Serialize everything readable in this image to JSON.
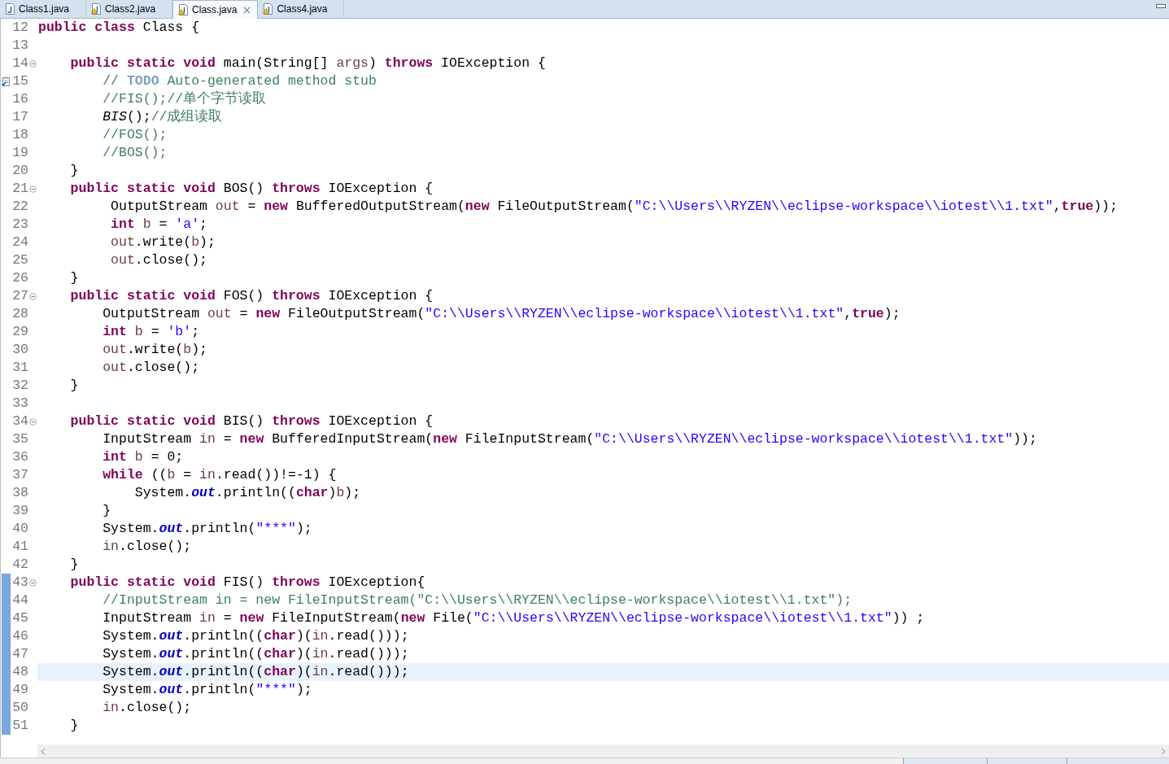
{
  "tabs": [
    {
      "label": "Class1.java",
      "selected": false,
      "warning": false
    },
    {
      "label": "Class2.java",
      "selected": false,
      "warning": true
    },
    {
      "label": "Class.java",
      "selected": true,
      "warning": true
    },
    {
      "label": "Class4.java",
      "selected": false,
      "warning": true
    }
  ],
  "lines": [
    {
      "number": "12",
      "fold": false,
      "changed": false,
      "current": false,
      "tokens": [
        {
          "kind": "kw",
          "text": "public class"
        },
        {
          "kind": "t",
          "text": " Class {"
        }
      ]
    },
    {
      "number": "13",
      "fold": false,
      "changed": false,
      "current": false
    },
    {
      "number": "14",
      "fold": true,
      "changed": false,
      "current": false,
      "tokens": [
        {
          "kind": "kw",
          "text": "    public static void"
        },
        {
          "kind": "t",
          "text": " main(String[] "
        },
        {
          "kind": "v",
          "text": "args"
        },
        {
          "kind": "t",
          "text": ") "
        },
        {
          "kind": "kw",
          "text": "throws"
        },
        {
          "kind": "t",
          "text": " IOException {"
        }
      ]
    },
    {
      "number": "15",
      "fold": false,
      "changed": false,
      "current": false,
      "task": true,
      "tokens": [
        {
          "kind": "c",
          "text": "        // "
        },
        {
          "kind": "todo",
          "text": "TODO"
        },
        {
          "kind": "c",
          "text": " Auto-generated method stub"
        }
      ]
    },
    {
      "number": "16",
      "fold": false,
      "changed": false,
      "current": false,
      "tokens": [
        {
          "kind": "c",
          "text": "        //FIS();//单个字节读取"
        }
      ]
    },
    {
      "number": "17",
      "fold": false,
      "changed": false,
      "current": false,
      "tokens": [
        {
          "kind": "sm",
          "text": "        BIS"
        },
        {
          "kind": "t",
          "text": "();"
        },
        {
          "kind": "c",
          "text": "//成组读取"
        }
      ]
    },
    {
      "number": "18",
      "fold": false,
      "changed": false,
      "current": false,
      "tokens": [
        {
          "kind": "c",
          "text": "        //FOS();"
        }
      ]
    },
    {
      "number": "19",
      "fold": false,
      "changed": false,
      "current": false,
      "tokens": [
        {
          "kind": "c",
          "text": "        //BOS();"
        }
      ]
    },
    {
      "number": "20",
      "fold": false,
      "changed": false,
      "current": false,
      "tokens": [
        {
          "kind": "t",
          "text": "    }"
        }
      ]
    },
    {
      "number": "21",
      "fold": true,
      "changed": false,
      "current": false,
      "tokens": [
        {
          "kind": "kw",
          "text": "    public static void"
        },
        {
          "kind": "t",
          "text": " BOS() "
        },
        {
          "kind": "kw",
          "text": "throws"
        },
        {
          "kind": "t",
          "text": " IOException {"
        }
      ]
    },
    {
      "number": "22",
      "fold": false,
      "changed": false,
      "current": false,
      "tokens": [
        {
          "kind": "t",
          "text": "         OutputStream "
        },
        {
          "kind": "v",
          "text": "out"
        },
        {
          "kind": "t",
          "text": " = "
        },
        {
          "kind": "kw",
          "text": "new"
        },
        {
          "kind": "t",
          "text": " BufferedOutputStream("
        },
        {
          "kind": "kw",
          "text": "new"
        },
        {
          "kind": "t",
          "text": " FileOutputStream("
        },
        {
          "kind": "s",
          "text": "\"C:\\\\Users\\\\RYZEN\\\\eclipse-workspace\\\\iotest\\\\1.txt\""
        },
        {
          "kind": "t",
          "text": ","
        },
        {
          "kind": "kw",
          "text": "true"
        },
        {
          "kind": "t",
          "text": "));"
        }
      ]
    },
    {
      "number": "23",
      "fold": false,
      "changed": false,
      "current": false,
      "tokens": [
        {
          "kind": "kw",
          "text": "         int"
        },
        {
          "kind": "v",
          "text": " b"
        },
        {
          "kind": "t",
          "text": " = "
        },
        {
          "kind": "s",
          "text": "'a'"
        },
        {
          "kind": "t",
          "text": ";"
        }
      ]
    },
    {
      "number": "24",
      "fold": false,
      "changed": false,
      "current": false,
      "tokens": [
        {
          "kind": "v",
          "text": "         out"
        },
        {
          "kind": "t",
          "text": ".write("
        },
        {
          "kind": "v",
          "text": "b"
        },
        {
          "kind": "t",
          "text": ");"
        }
      ]
    },
    {
      "number": "25",
      "fold": false,
      "changed": false,
      "current": false,
      "tokens": [
        {
          "kind": "v",
          "text": "         out"
        },
        {
          "kind": "t",
          "text": ".close();"
        }
      ]
    },
    {
      "number": "26",
      "fold": false,
      "changed": false,
      "current": false,
      "tokens": [
        {
          "kind": "t",
          "text": "    }"
        }
      ]
    },
    {
      "number": "27",
      "fold": true,
      "changed": false,
      "current": false,
      "tokens": [
        {
          "kind": "kw",
          "text": "    public static void"
        },
        {
          "kind": "t",
          "text": " FOS() "
        },
        {
          "kind": "kw",
          "text": "throws"
        },
        {
          "kind": "t",
          "text": " IOException {"
        }
      ]
    },
    {
      "number": "28",
      "fold": false,
      "changed": false,
      "current": false,
      "tokens": [
        {
          "kind": "t",
          "text": "        OutputStream "
        },
        {
          "kind": "v",
          "text": "out"
        },
        {
          "kind": "t",
          "text": " = "
        },
        {
          "kind": "kw",
          "text": "new"
        },
        {
          "kind": "t",
          "text": " FileOutputStream("
        },
        {
          "kind": "s",
          "text": "\"C:\\\\Users\\\\RYZEN\\\\eclipse-workspace\\\\iotest\\\\1.txt\""
        },
        {
          "kind": "t",
          "text": ","
        },
        {
          "kind": "kw",
          "text": "true"
        },
        {
          "kind": "t",
          "text": ");"
        }
      ]
    },
    {
      "number": "29",
      "fold": false,
      "changed": false,
      "current": false,
      "tokens": [
        {
          "kind": "kw",
          "text": "        int"
        },
        {
          "kind": "v",
          "text": " b"
        },
        {
          "kind": "t",
          "text": " = "
        },
        {
          "kind": "s",
          "text": "'b'"
        },
        {
          "kind": "t",
          "text": ";"
        }
      ]
    },
    {
      "number": "30",
      "fold": false,
      "changed": false,
      "current": false,
      "tokens": [
        {
          "kind": "v",
          "text": "        out"
        },
        {
          "kind": "t",
          "text": ".write("
        },
        {
          "kind": "v",
          "text": "b"
        },
        {
          "kind": "t",
          "text": ");"
        }
      ]
    },
    {
      "number": "31",
      "fold": false,
      "changed": false,
      "current": false,
      "tokens": [
        {
          "kind": "v",
          "text": "        out"
        },
        {
          "kind": "t",
          "text": ".close();"
        }
      ]
    },
    {
      "number": "32",
      "fold": false,
      "changed": false,
      "current": false,
      "tokens": [
        {
          "kind": "t",
          "text": "    }"
        }
      ]
    },
    {
      "number": "33",
      "fold": false,
      "changed": false,
      "current": false
    },
    {
      "number": "34",
      "fold": true,
      "changed": false,
      "current": false,
      "tokens": [
        {
          "kind": "kw",
          "text": "    public static void"
        },
        {
          "kind": "t",
          "text": " BIS() "
        },
        {
          "kind": "kw",
          "text": "throws"
        },
        {
          "kind": "t",
          "text": " IOException {"
        }
      ]
    },
    {
      "number": "35",
      "fold": false,
      "changed": false,
      "current": false,
      "tokens": [
        {
          "kind": "t",
          "text": "        InputStream "
        },
        {
          "kind": "v",
          "text": "in"
        },
        {
          "kind": "t",
          "text": " = "
        },
        {
          "kind": "kw",
          "text": "new"
        },
        {
          "kind": "t",
          "text": " BufferedInputStream("
        },
        {
          "kind": "kw",
          "text": "new"
        },
        {
          "kind": "t",
          "text": " FileInputStream("
        },
        {
          "kind": "s",
          "text": "\"C:\\\\Users\\\\RYZEN\\\\eclipse-workspace\\\\iotest\\\\1.txt\""
        },
        {
          "kind": "t",
          "text": "));"
        }
      ]
    },
    {
      "number": "36",
      "fold": false,
      "changed": false,
      "current": false,
      "tokens": [
        {
          "kind": "kw",
          "text": "        int"
        },
        {
          "kind": "v",
          "text": " b"
        },
        {
          "kind": "t",
          "text": " = 0;"
        }
      ]
    },
    {
      "number": "37",
      "fold": false,
      "changed": false,
      "current": false,
      "tokens": [
        {
          "kind": "kw",
          "text": "        while"
        },
        {
          "kind": "t",
          "text": " (("
        },
        {
          "kind": "v",
          "text": "b"
        },
        {
          "kind": "t",
          "text": " = "
        },
        {
          "kind": "v",
          "text": "in"
        },
        {
          "kind": "t",
          "text": ".read())!=-1) {"
        }
      ]
    },
    {
      "number": "38",
      "fold": false,
      "changed": false,
      "current": false,
      "tokens": [
        {
          "kind": "t",
          "text": "            System."
        },
        {
          "kind": "f",
          "text": "out"
        },
        {
          "kind": "t",
          "text": ".println(("
        },
        {
          "kind": "kw",
          "text": "char"
        },
        {
          "kind": "t",
          "text": ")"
        },
        {
          "kind": "v",
          "text": "b"
        },
        {
          "kind": "t",
          "text": ");"
        }
      ]
    },
    {
      "number": "39",
      "fold": false,
      "changed": false,
      "current": false,
      "tokens": [
        {
          "kind": "t",
          "text": "        }"
        }
      ]
    },
    {
      "number": "40",
      "fold": false,
      "changed": false,
      "current": false,
      "tokens": [
        {
          "kind": "t",
          "text": "        System."
        },
        {
          "kind": "f",
          "text": "out"
        },
        {
          "kind": "t",
          "text": ".println("
        },
        {
          "kind": "s",
          "text": "\"***\""
        },
        {
          "kind": "t",
          "text": ");"
        }
      ]
    },
    {
      "number": "41",
      "fold": false,
      "changed": false,
      "current": false,
      "tokens": [
        {
          "kind": "v",
          "text": "        in"
        },
        {
          "kind": "t",
          "text": ".close();"
        }
      ]
    },
    {
      "number": "42",
      "fold": false,
      "changed": false,
      "current": false,
      "tokens": [
        {
          "kind": "t",
          "text": "    }"
        }
      ]
    },
    {
      "number": "43",
      "fold": true,
      "changed": true,
      "current": false,
      "tokens": [
        {
          "kind": "kw",
          "text": "    public static void"
        },
        {
          "kind": "t",
          "text": " FIS() "
        },
        {
          "kind": "kw",
          "text": "throws"
        },
        {
          "kind": "t",
          "text": " IOException{"
        }
      ]
    },
    {
      "number": "44",
      "fold": false,
      "changed": true,
      "current": false,
      "tokens": [
        {
          "kind": "c",
          "text": "        //InputStream in = new FileInputStream(\"C:\\\\Users\\\\RYZEN\\\\eclipse-workspace\\\\iotest\\\\1.txt\");"
        }
      ]
    },
    {
      "number": "45",
      "fold": false,
      "changed": true,
      "current": false,
      "tokens": [
        {
          "kind": "t",
          "text": "        InputStream "
        },
        {
          "kind": "v",
          "text": "in"
        },
        {
          "kind": "t",
          "text": " = "
        },
        {
          "kind": "kw",
          "text": "new"
        },
        {
          "kind": "t",
          "text": " FileInputStream("
        },
        {
          "kind": "kw",
          "text": "new"
        },
        {
          "kind": "t",
          "text": " File("
        },
        {
          "kind": "s",
          "text": "\"C:\\\\Users\\\\RYZEN\\\\eclipse-workspace\\\\iotest\\\\1.txt\""
        },
        {
          "kind": "t",
          "text": ")) ;"
        }
      ]
    },
    {
      "number": "46",
      "fold": false,
      "changed": true,
      "current": false,
      "tokens": [
        {
          "kind": "t",
          "text": "        System."
        },
        {
          "kind": "f",
          "text": "out"
        },
        {
          "kind": "t",
          "text": ".println(("
        },
        {
          "kind": "kw",
          "text": "char"
        },
        {
          "kind": "t",
          "text": ")("
        },
        {
          "kind": "v",
          "text": "in"
        },
        {
          "kind": "t",
          "text": ".read()));"
        }
      ]
    },
    {
      "number": "47",
      "fold": false,
      "changed": true,
      "current": false,
      "tokens": [
        {
          "kind": "t",
          "text": "        System."
        },
        {
          "kind": "f",
          "text": "out"
        },
        {
          "kind": "t",
          "text": ".println(("
        },
        {
          "kind": "kw",
          "text": "char"
        },
        {
          "kind": "t",
          "text": ")("
        },
        {
          "kind": "v",
          "text": "in"
        },
        {
          "kind": "t",
          "text": ".read()));"
        }
      ]
    },
    {
      "number": "48",
      "fold": false,
      "changed": true,
      "current": true,
      "tokens": [
        {
          "kind": "t",
          "text": "        System."
        },
        {
          "kind": "f",
          "text": "out"
        },
        {
          "kind": "t",
          "text": ".println(("
        },
        {
          "kind": "kw",
          "text": "char"
        },
        {
          "kind": "t",
          "text": ")("
        },
        {
          "kind": "v",
          "text": "in"
        },
        {
          "kind": "t",
          "text": ".read()));"
        }
      ]
    },
    {
      "number": "49",
      "fold": false,
      "changed": true,
      "current": false,
      "tokens": [
        {
          "kind": "t",
          "text": "        System."
        },
        {
          "kind": "f",
          "text": "out"
        },
        {
          "kind": "t",
          "text": ".println("
        },
        {
          "kind": "s",
          "text": "\"***\""
        },
        {
          "kind": "t",
          "text": ");"
        }
      ]
    },
    {
      "number": "50",
      "fold": false,
      "changed": true,
      "current": false,
      "tokens": [
        {
          "kind": "v",
          "text": "        in"
        },
        {
          "kind": "t",
          "text": ".close();"
        }
      ]
    },
    {
      "number": "51",
      "fold": false,
      "changed": true,
      "current": false,
      "tokens": [
        {
          "kind": "t",
          "text": "    }"
        }
      ]
    }
  ]
}
